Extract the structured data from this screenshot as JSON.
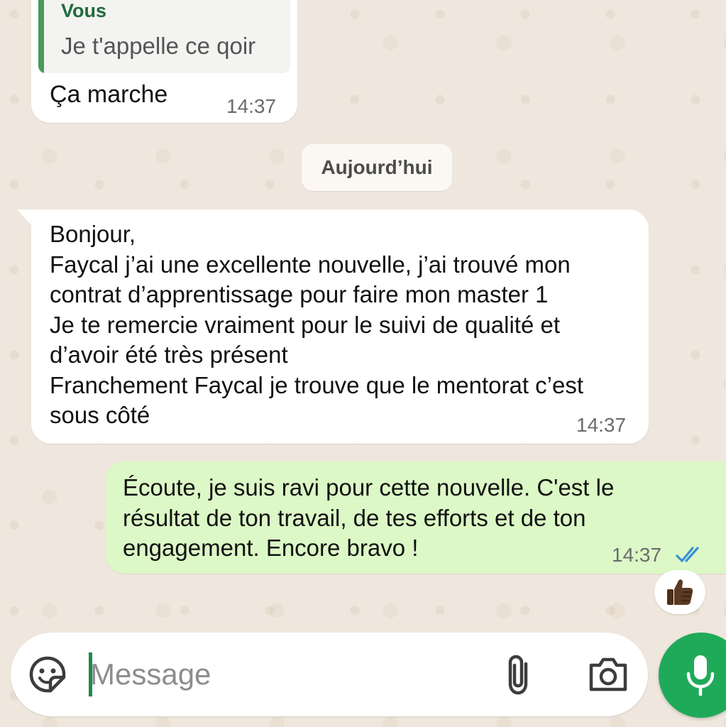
{
  "chat": {
    "messages": [
      {
        "direction": "outgoing",
        "quoted": {
          "author": "Vous",
          "text": "Je t'appelle ce qoir"
        },
        "text": "Ça marche",
        "time": "14:37"
      }
    ],
    "date_separator": "Aujourd’hui",
    "incoming": {
      "lines": [
        "Bonjour,",
        "Faycal j’ai une excellente nouvelle, j’ai trouvé mon",
        "contrat d’apprentissage pour faire mon master 1",
        "Je te remercie vraiment pour le suivi de qualité et",
        "d’avoir été très présent",
        "Franchement Faycal je trouve que le mentorat c’est",
        "sous côté"
      ],
      "time": "14:37"
    },
    "outgoing": {
      "lines": [
        "Écoute, je suis ravi pour cette nouvelle. C'est le",
        "résultat de ton travail, de tes efforts et de ton",
        "engagement. Encore bravo !"
      ],
      "time": "14:37",
      "status_icon": "double-check-read-icon",
      "status_color": "#3a8fd8"
    },
    "reaction": {
      "emoji": "👍🏿",
      "icon": "thumbs-up-icon"
    }
  },
  "composer": {
    "placeholder": "Message",
    "icons": [
      "sticker-icon",
      "paperclip-icon",
      "camera-icon",
      "microphone-icon"
    ],
    "mic_color": "#1faa59"
  }
}
